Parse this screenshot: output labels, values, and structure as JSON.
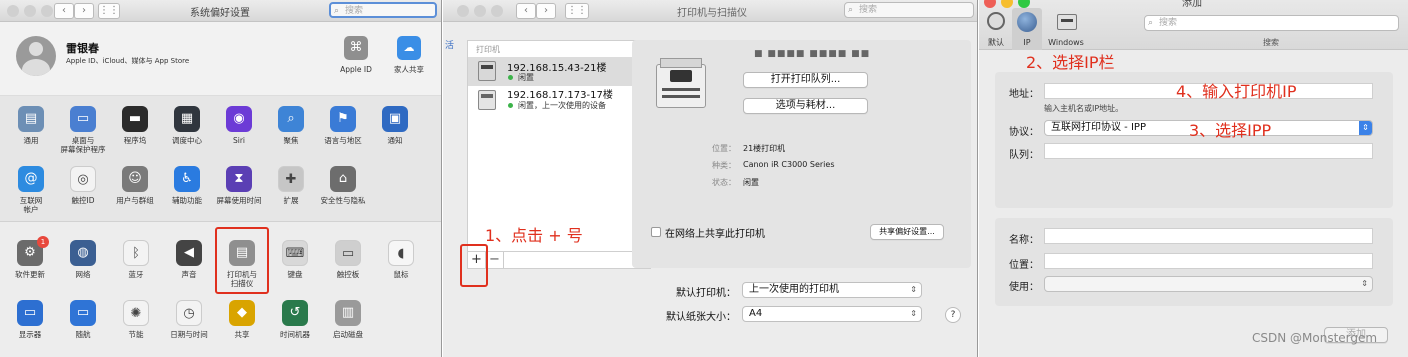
{
  "panel1": {
    "title": "系统偏好设置",
    "search_placeholder": "搜索",
    "user": {
      "name": "雷银春",
      "subtitle": "Apple ID、iCloud、媒体与 App Store"
    },
    "top_items": [
      {
        "label": "Apple ID"
      },
      {
        "label": "家人共享"
      }
    ],
    "row1": [
      {
        "label": "通用",
        "icon": "general-icon"
      },
      {
        "label": "桌面与\n屏幕保护程序",
        "icon": "desktop-icon"
      },
      {
        "label": "程序坞",
        "icon": "dock-icon"
      },
      {
        "label": "调度中心",
        "icon": "mission-control-icon"
      },
      {
        "label": "Siri",
        "icon": "siri-icon"
      },
      {
        "label": "聚焦",
        "icon": "spotlight-icon"
      },
      {
        "label": "语言与地区",
        "icon": "language-icon"
      },
      {
        "label": "通知",
        "icon": "notifications-icon"
      }
    ],
    "row2": [
      {
        "label": "互联网\n帐户",
        "icon": "internet-accounts-icon"
      },
      {
        "label": "触控ID",
        "icon": "touch-id-icon"
      },
      {
        "label": "用户与群组",
        "icon": "users-icon"
      },
      {
        "label": "辅助功能",
        "icon": "accessibility-icon"
      },
      {
        "label": "屏幕使用时间",
        "icon": "screen-time-icon"
      },
      {
        "label": "扩展",
        "icon": "extensions-icon"
      },
      {
        "label": "安全性与隐私",
        "icon": "security-icon"
      }
    ],
    "row3": [
      {
        "label": "软件更新",
        "icon": "software-update-icon",
        "badge": "1"
      },
      {
        "label": "网络",
        "icon": "network-icon"
      },
      {
        "label": "蓝牙",
        "icon": "bluetooth-icon"
      },
      {
        "label": "声音",
        "icon": "sound-icon"
      },
      {
        "label": "打印机与\n扫描仪",
        "icon": "printer-icon"
      },
      {
        "label": "键盘",
        "icon": "keyboard-icon"
      },
      {
        "label": "触控板",
        "icon": "trackpad-icon"
      },
      {
        "label": "鼠标",
        "icon": "mouse-icon"
      }
    ],
    "row4": [
      {
        "label": "显示器",
        "icon": "display-icon"
      },
      {
        "label": "随航",
        "icon": "sidecar-icon"
      },
      {
        "label": "节能",
        "icon": "energy-icon"
      },
      {
        "label": "日期与时间",
        "icon": "date-time-icon"
      },
      {
        "label": "共享",
        "icon": "sharing-icon"
      },
      {
        "label": "时间机器",
        "icon": "time-machine-icon"
      },
      {
        "label": "启动磁盘",
        "icon": "startup-disk-icon"
      }
    ]
  },
  "panel2": {
    "title": "打印机与扫描仪",
    "search_placeholder": "搜索",
    "list_header": "打印机",
    "printers": [
      {
        "name": "192.168.15.43-21楼",
        "status": "闲置"
      },
      {
        "name": "192.168.17.173-17楼",
        "status": "闲置，上一次使用的设备"
      }
    ],
    "printer_name_mask": "■ ■■■■ ■■■■ ■■",
    "open_queue_button": "打开打印队列...",
    "options_button": "选项与耗材...",
    "details": [
      {
        "key": "位置：",
        "value": "21楼打印机"
      },
      {
        "key": "种类：",
        "value": "Canon iR C3000 Series"
      },
      {
        "key": "状态：",
        "value": "闲置"
      }
    ],
    "share_checkbox": "在网络上共享此打印机",
    "share_prefs_button": "共享偏好设置...",
    "default_printer_label": "默认打印机：",
    "default_printer_value": "上一次使用的打印机",
    "paper_size_label": "默认纸张大小：",
    "paper_size_value": "A4",
    "add_button": "+",
    "remove_button": "−",
    "help_button": "?",
    "annotation": "1、点击 + 号"
  },
  "panel3": {
    "title": "添加",
    "search_placeholder": "搜索",
    "search_caption": "搜索",
    "tabs": [
      {
        "label": "默认"
      },
      {
        "label": "IP"
      },
      {
        "label": "Windows"
      }
    ],
    "address_label": "地址：",
    "address_hint": "输入主机名或IP地址。",
    "protocol_label": "协议：",
    "protocol_value": "互联网打印协议 - IPP",
    "queue_label": "队列：",
    "name_label": "名称：",
    "location_label": "位置：",
    "use_label": "使用：",
    "add_button": "添加",
    "annotations": {
      "step2": "2、选择IP栏",
      "step4": "4、输入打印机IP",
      "step3": "3、选择IPP"
    }
  },
  "watermark": "CSDN @Monstergem"
}
